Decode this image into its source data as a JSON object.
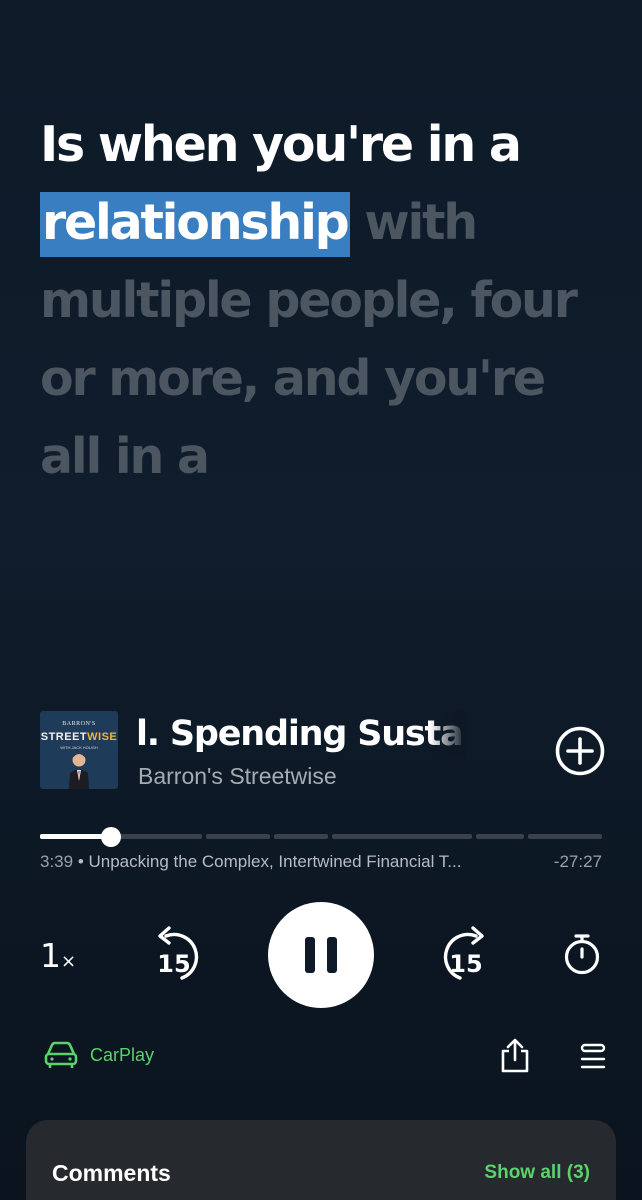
{
  "transcript": {
    "spoken": "Is when you're in a ",
    "highlight": "relationship",
    "upcoming": " with multiple people, four or more, and you're all in a"
  },
  "now_playing": {
    "artwork": {
      "brand": "BARRON'S",
      "logo_part1": "STREET",
      "logo_part2": "WISE",
      "subtitle": "WITH JACK HOUGH"
    },
    "episode_title": "l. Spending Sustaina",
    "show_name": "Barron's Streetwise"
  },
  "playback": {
    "position": "3:39",
    "separator": " • ",
    "chapter": "Unpacking the Complex, Intertwined Financial T...",
    "remaining": "-27:27",
    "progress_fraction": 0.126,
    "speed_value": "1",
    "speed_unit": "×",
    "skip_back_seconds": "15",
    "skip_forward_seconds": "15",
    "state": "playing"
  },
  "footer": {
    "carplay_label": "CarPlay"
  },
  "comments": {
    "title": "Comments",
    "show_all": "Show all (3)"
  },
  "colors": {
    "accent_green": "#5bd26b",
    "highlight_blue": "#3a7ec2",
    "background": "#0e1a28"
  }
}
